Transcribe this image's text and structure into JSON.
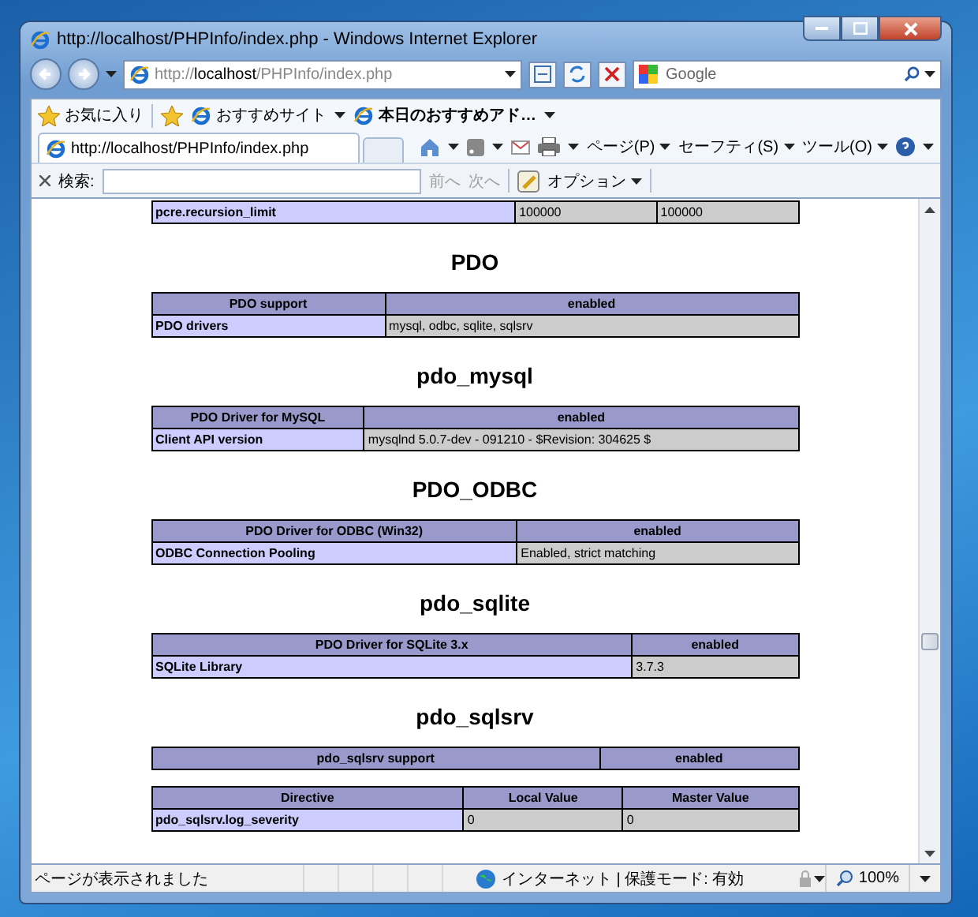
{
  "window": {
    "title": "http://localhost/PHPInfo/index.php - Windows Internet Explorer"
  },
  "address": {
    "scheme": "http://",
    "host": "localhost",
    "path": "/PHPInfo/index.php"
  },
  "search": {
    "placeholder": "Google"
  },
  "favorites_bar": {
    "favorites": "お気に入り",
    "links": [
      {
        "label": "おすすめサイト"
      },
      {
        "label": "本日のおすすめアド…"
      }
    ]
  },
  "tabs": [
    {
      "label": "http://localhost/PHPInfo/index.php",
      "selected": true
    }
  ],
  "command_bar": [
    "ページ(P)",
    "セーフティ(S)",
    "ツール(O)"
  ],
  "find_bar": {
    "label": "検索:",
    "buttons": [
      {
        "label": "前へ",
        "disabled": true
      },
      {
        "label": "次へ",
        "disabled": true
      }
    ],
    "options": "オプション"
  },
  "sections": [
    {
      "tables": [
        {
          "rows": [
            {
              "kind": "row",
              "cells": [
                "pcre.recursion_limit",
                "100000",
                "100000"
              ]
            }
          ]
        }
      ]
    },
    {
      "heading": "PDO",
      "tables": [
        {
          "rows": [
            {
              "kind": "header",
              "cells": [
                "PDO support",
                "enabled"
              ]
            },
            {
              "kind": "row",
              "cells": [
                "PDO drivers",
                "mysql, odbc, sqlite, sqlsrv"
              ]
            }
          ]
        }
      ]
    },
    {
      "heading": "pdo_mysql",
      "tables": [
        {
          "rows": [
            {
              "kind": "header",
              "cells": [
                "PDO Driver for MySQL",
                "enabled"
              ]
            },
            {
              "kind": "row",
              "cells": [
                "Client API version",
                "mysqlnd 5.0.7-dev - 091210 - $Revision: 304625 $"
              ]
            }
          ]
        }
      ]
    },
    {
      "heading": "PDO_ODBC",
      "tables": [
        {
          "rows": [
            {
              "kind": "header",
              "cells": [
                "PDO Driver for ODBC (Win32)",
                "enabled"
              ]
            },
            {
              "kind": "row",
              "cells": [
                "ODBC Connection Pooling",
                "Enabled, strict matching"
              ]
            }
          ]
        }
      ]
    },
    {
      "heading": "pdo_sqlite",
      "tables": [
        {
          "rows": [
            {
              "kind": "header",
              "cells": [
                "PDO Driver for SQLite 3.x",
                "enabled"
              ]
            },
            {
              "kind": "row",
              "cells": [
                "SQLite Library",
                "3.7.3"
              ]
            }
          ]
        }
      ]
    },
    {
      "heading": "pdo_sqlsrv",
      "tables": [
        {
          "rows": [
            {
              "kind": "header",
              "cells": [
                "pdo_sqlsrv support",
                "enabled"
              ]
            }
          ]
        },
        {
          "rows": [
            {
              "kind": "header",
              "cells": [
                "Directive",
                "Local Value",
                "Master Value"
              ]
            },
            {
              "kind": "row",
              "cells": [
                "pdo_sqlsrv.log_severity",
                "0",
                "0"
              ]
            }
          ]
        }
      ]
    }
  ],
  "status_bar": {
    "text": "ページが表示されました",
    "zone": "インターネット | 保護モード: 有効",
    "zoom": "100%"
  }
}
